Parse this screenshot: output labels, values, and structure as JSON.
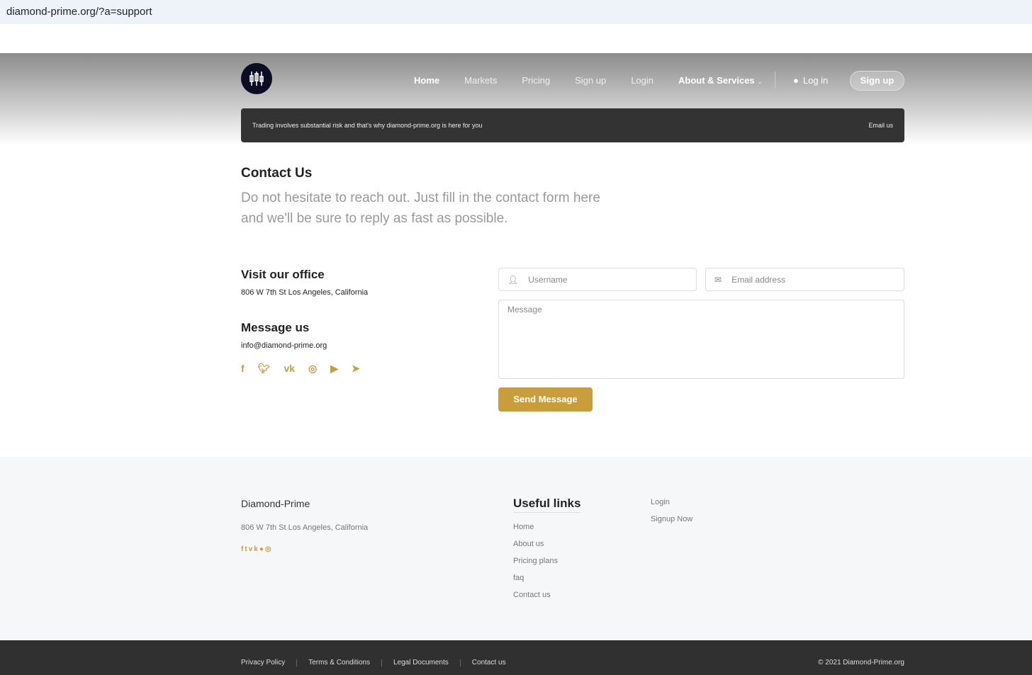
{
  "browser": {
    "url": "diamond-prime.org/?a=support"
  },
  "nav": {
    "items": [
      "Home",
      "Markets",
      "Pricing",
      "Sign up",
      "Login",
      "About & Services"
    ],
    "login": "Log in",
    "signup": "Sign up"
  },
  "banner": {
    "text": "Trading involves substantial risk and that's why diamond-prime.org is here for you",
    "email": "Email us"
  },
  "contact": {
    "title": "Contact Us",
    "lead": "Do not hesitate to reach out. Just fill in the contact form here and we'll be sure to reply as fast as possible.",
    "office_title": "Visit our office",
    "address": "806 W 7th St Los Angeles, California",
    "message_title": "Message us",
    "email": "info@diamond-prime.org",
    "social": [
      "facebook",
      "twitter",
      "vk",
      "instagram",
      "youtube",
      "telegram"
    ]
  },
  "form": {
    "username_placeholder": "Username",
    "email_placeholder": "Email address",
    "message_placeholder": "Message",
    "send": "Send Message"
  },
  "footer": {
    "brand": "Diamond-Prime",
    "address": "806 W 7th St Los Angeles, California",
    "useful_title": "Useful links",
    "links": [
      "Home",
      "About us",
      "Pricing plans",
      "faq",
      "Contact us"
    ],
    "links2": [
      "Login",
      "Signup Now"
    ],
    "bottom": [
      "Privacy Policy",
      "Terms & Conditions",
      "Legal Documents",
      "Contact us"
    ],
    "copyright": "© 2021 Diamond-Prime.org"
  },
  "colors": {
    "accent": "#c99d3a",
    "dark": "#303030"
  }
}
